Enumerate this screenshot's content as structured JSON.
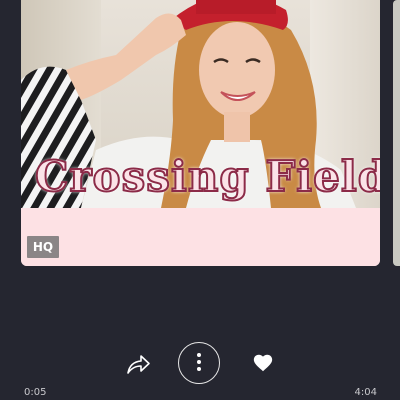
{
  "album_card": {
    "title_art_text": "Crossing Field",
    "quality_badge": "HQ",
    "bottom_color": "#fde1e4",
    "title_outline_color": "#8c2b48"
  },
  "controls": {
    "share_icon": "share-arrow-icon",
    "more_icon": "more-vertical-icon",
    "like_icon": "heart-icon"
  },
  "playback": {
    "elapsed": "0:05",
    "total": "4:04"
  },
  "colors": {
    "background": "#252630",
    "icon": "#ffffff"
  }
}
